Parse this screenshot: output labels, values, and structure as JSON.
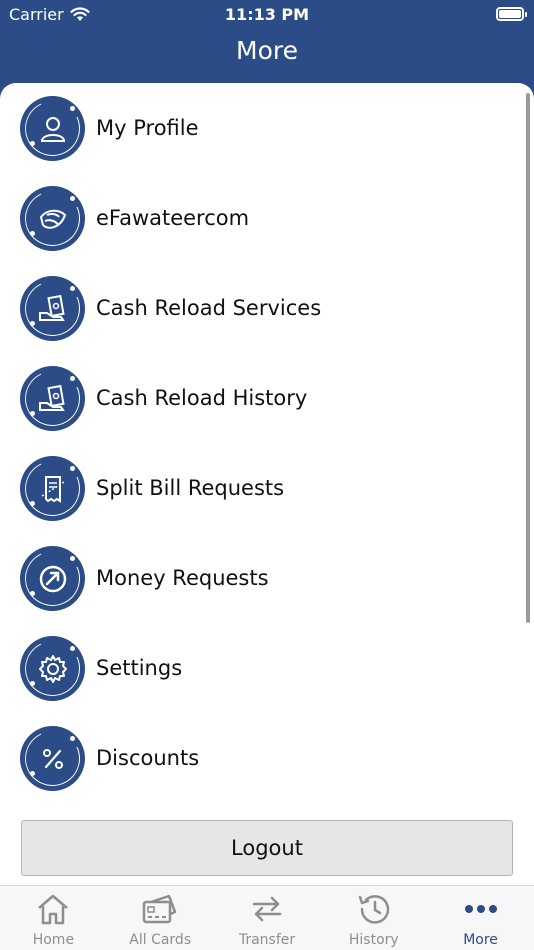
{
  "status_bar": {
    "carrier": "Carrier",
    "time": "11:13 PM"
  },
  "header": {
    "title": "More"
  },
  "menu": {
    "items": [
      {
        "label": "My Profile",
        "icon": "user-icon"
      },
      {
        "label": "eFawateercom",
        "icon": "efawateercom-icon"
      },
      {
        "label": "Cash Reload Services",
        "icon": "cash-reload-icon"
      },
      {
        "label": "Cash Reload History",
        "icon": "cash-history-icon"
      },
      {
        "label": "Split Bill Requests",
        "icon": "split-bill-icon"
      },
      {
        "label": "Money Requests",
        "icon": "money-request-icon"
      },
      {
        "label": "Settings",
        "icon": "gear-icon"
      },
      {
        "label": "Discounts",
        "icon": "percent-icon"
      }
    ]
  },
  "logout": {
    "label": "Logout"
  },
  "tabs": [
    {
      "label": "Home",
      "icon": "home-icon"
    },
    {
      "label": "All Cards",
      "icon": "cards-icon"
    },
    {
      "label": "Transfer",
      "icon": "transfer-icon"
    },
    {
      "label": "History",
      "icon": "history-icon"
    },
    {
      "label": "More",
      "icon": "more-icon",
      "active": true
    }
  ],
  "colors": {
    "brand": "#2b4c86",
    "tab_inactive": "#8e8e8e",
    "background": "#ffffff"
  }
}
